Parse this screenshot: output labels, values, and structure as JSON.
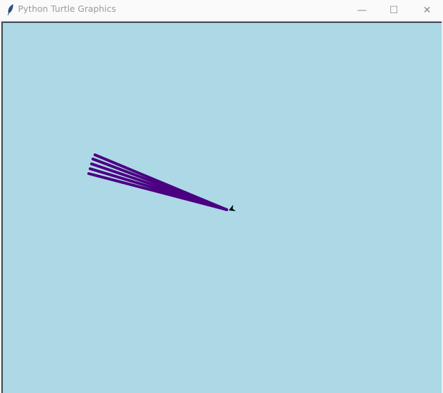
{
  "window": {
    "title": "Python Turtle Graphics",
    "icon": "feather-icon"
  },
  "controls": {
    "minimize": "—",
    "maximize": "☐",
    "close": "✕"
  },
  "canvas": {
    "background": "#add8e6",
    "pen_color": "#4b0082",
    "turtle_color": "#000000",
    "lines": [
      {
        "from": [
          0,
          0
        ],
        "to": [
          -190,
          79
        ]
      },
      {
        "from": [
          0,
          0
        ],
        "to": [
          -193,
          73
        ]
      },
      {
        "from": [
          0,
          0
        ],
        "to": [
          -195,
          66
        ]
      },
      {
        "from": [
          0,
          0
        ],
        "to": [
          -197,
          59
        ]
      },
      {
        "from": [
          0,
          0
        ],
        "to": [
          -199,
          52
        ]
      }
    ]
  }
}
